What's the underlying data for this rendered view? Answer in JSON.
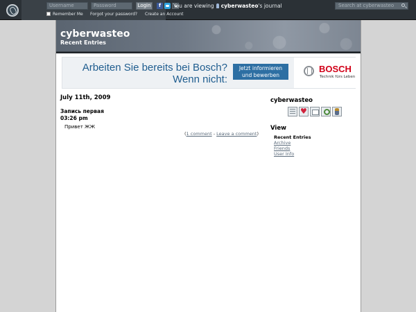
{
  "topbar": {
    "username_placeholder": "Username",
    "password_placeholder": "Password",
    "login_label": "Login",
    "remember_label": "Remember Me",
    "forgot_label": "Forgot your password?",
    "create_label": "Create an Account",
    "viewing_prefix": "You are viewing",
    "viewing_user": "cyberwasteo",
    "viewing_suffix": "'s journal",
    "search_placeholder": "Search at cyberwasteo"
  },
  "header": {
    "title": "cyberwasteo",
    "subtitle": "Recent Entries"
  },
  "ad": {
    "headline_line1": "Arbeiten Sie bereits bei Bosch?",
    "headline_line2": "Wenn nicht:",
    "cta_line1": "Jetzt informieren",
    "cta_line2": "und bewerben",
    "brand": "BOSCH",
    "tagline": "Technik fürs Leben"
  },
  "entry": {
    "date": "July 11th, 2009",
    "subject": "Запись первая",
    "time": "03:26 pm",
    "body": "Привет ЖЖ",
    "links_open": "(",
    "comment_link": "1 comment",
    "links_sep": " - ",
    "leave_link": "Leave a comment",
    "links_close": ")"
  },
  "sidebar": {
    "username": "cyberwasteo",
    "icons": [
      "profile-icon",
      "add-friend-icon",
      "message-icon",
      "search-icon",
      "tracking-icon"
    ],
    "view_title": "View",
    "nav_current": "Recent Entries",
    "nav_links": [
      "Archive",
      "Friends",
      "User Info"
    ]
  },
  "colors": {
    "topbar": "#2b3136",
    "page_background": "#d4d4d4",
    "link": "#5a6a7a",
    "bosch_red": "#d10018",
    "ad_blue": "#1f5d8f"
  }
}
